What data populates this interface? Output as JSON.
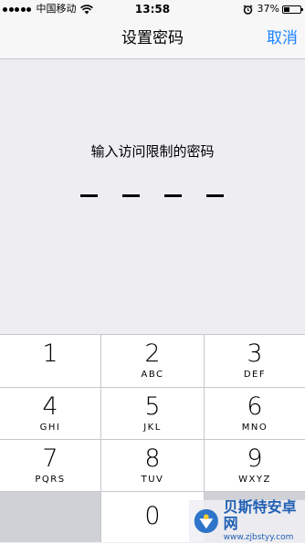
{
  "status_bar": {
    "carrier": "中国移动",
    "time": "13:58",
    "battery_percent": "37%",
    "battery_level": 0.37,
    "signal_dots_filled": 4,
    "signal_dots_total": 5,
    "icons": [
      "signal-dots-icon",
      "wifi-icon",
      "alarm-icon",
      "battery-icon"
    ]
  },
  "nav": {
    "title": "设置密码",
    "cancel_label": "取消",
    "accent_color": "#1a82fb"
  },
  "passcode": {
    "prompt": "输入访问限制的密码",
    "length": 4,
    "entered": 0
  },
  "keypad": {
    "keys": [
      {
        "num": "1",
        "letters": ""
      },
      {
        "num": "2",
        "letters": "ABC"
      },
      {
        "num": "3",
        "letters": "DEF"
      },
      {
        "num": "4",
        "letters": "GHI"
      },
      {
        "num": "5",
        "letters": "JKL"
      },
      {
        "num": "6",
        "letters": "MNO"
      },
      {
        "num": "7",
        "letters": "PQRS"
      },
      {
        "num": "8",
        "letters": "TUV"
      },
      {
        "num": "9",
        "letters": "WXYZ"
      }
    ],
    "zero": {
      "num": "0",
      "letters": ""
    }
  },
  "watermark": {
    "name": "贝斯特安卓网",
    "url": "www.zjbstyy.com"
  }
}
